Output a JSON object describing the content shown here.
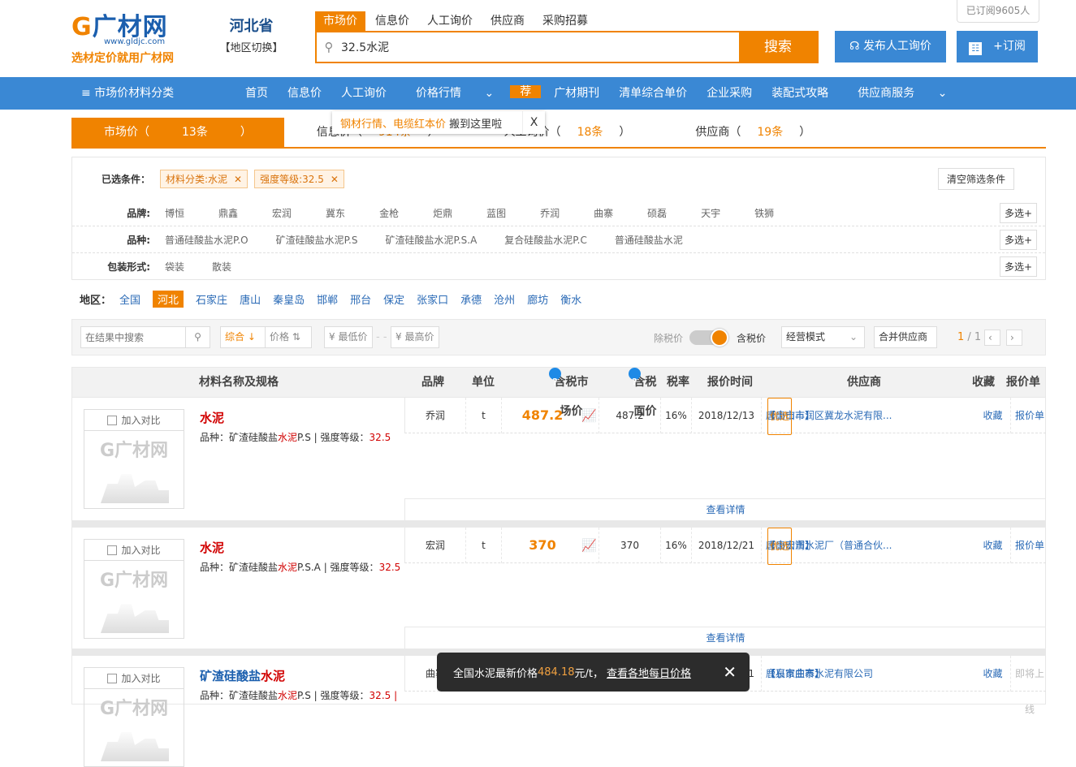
{
  "header": {
    "logo_text": "广材网",
    "logo_url": "www.gldjc.com",
    "slogan": "选材定价就用广材网",
    "province": "河北省",
    "region_switch": "【地区切换】",
    "subscribed": "已订阅9605人",
    "search_tabs": [
      "市场价",
      "信息价",
      "人工询价",
      "供应商",
      "采购招募"
    ],
    "search_value": "32.5水泥",
    "search_button": "搜索",
    "publish_button": "发布人工询价",
    "subscribe_button": "+订阅"
  },
  "nav": {
    "category": "≡ 市场价材料分类",
    "items": [
      "首页",
      "信息价",
      "人工询价",
      "价格行情",
      "广材期刊",
      "清单综合单价",
      "企业采购",
      "装配式攻略",
      "供应商服务"
    ],
    "tag": "荐"
  },
  "tooltip": {
    "highlight": "钢材行情、电缆红本价",
    "text": " 搬到这里啦",
    "close": "X"
  },
  "result_tabs": [
    {
      "label": "市场价（",
      "count": "13条",
      "end": "）"
    },
    {
      "label": "信息价（",
      "count": "914条",
      "end": "）"
    },
    {
      "label": "人工询价（",
      "count": "18条",
      "end": "）"
    },
    {
      "label": "供应商（",
      "count": "19条",
      "end": "）"
    }
  ],
  "filters": {
    "selected_label": "已选条件：",
    "chips": [
      "材料分类:水泥",
      "强度等级:32.5"
    ],
    "clear": "清空筛选条件",
    "brand_label": "品牌:",
    "brands": [
      "博恒",
      "鼎鑫",
      "宏润",
      "冀东",
      "金枪",
      "炬鼎",
      "蓝图",
      "乔润",
      "曲寨",
      "硕磊",
      "天宇",
      "铁狮"
    ],
    "variety_label": "品种:",
    "varieties": [
      "普通硅酸盐水泥P.O",
      "矿渣硅酸盐水泥P.S",
      "矿渣硅酸盐水泥P.S.A",
      "复合硅酸盐水泥P.C",
      "普通硅酸盐水泥"
    ],
    "pack_label": "包装形式:",
    "packs": [
      "袋装",
      "散装"
    ],
    "multi": "多选+"
  },
  "region": {
    "label": "地区：",
    "items": [
      "全国",
      "河北",
      "石家庄",
      "唐山",
      "秦皇岛",
      "邯郸",
      "邢台",
      "保定",
      "张家口",
      "承德",
      "沧州",
      "廊坊",
      "衡水"
    ],
    "selected": "河北"
  },
  "toolbar": {
    "search_placeholder": "在结果中搜索",
    "sort_default": "综合 ↓",
    "sort_price": "价格",
    "min_price": "¥ 最低价",
    "max_price": "¥ 最高价",
    "ex_tax": "除税价",
    "in_tax": "含税价",
    "mode": "经营模式",
    "merge": "合并供应商",
    "page_cur": "1",
    "page_total": "/ 1"
  },
  "table": {
    "headers": [
      "材料名称及规格",
      "品牌",
      "单位",
      "含税市场价",
      "含税面价",
      "税率",
      "报价时间",
      "供应商",
      "收藏",
      "报价单"
    ],
    "compare": "加入对比",
    "detail": "查看详情",
    "spec_prefix": "品种：",
    "grade_sep": " | 强度等级：",
    "rows": [
      {
        "name": "水泥",
        "spec_a": "矿渣硅酸盐",
        "spec_hl": "水泥",
        "spec_b": "P.S",
        "grade": "32.5",
        "brand": "乔润",
        "unit": "t",
        "price": "487.2",
        "face": "487.2",
        "tax": "16%",
        "date": "2018/12/13",
        "city": "【唐山市】",
        "supplier": "唐山市丰润区冀龙水泥有限...",
        "badge": "优选",
        "fav": "收藏",
        "quote": "报价单"
      },
      {
        "name": "水泥",
        "spec_a": "矿渣硅酸盐",
        "spec_hl": "水泥",
        "spec_b": "P.S.A",
        "grade": "32.5",
        "brand": "宏润",
        "unit": "t",
        "price": "370",
        "face": "370",
        "tax": "16%",
        "date": "2018/12/21",
        "city": "【唐山市】",
        "supplier": "唐山宏润水泥厂（普通合伙...",
        "badge": "优选",
        "fav": "收藏",
        "quote": "报价单"
      },
      {
        "name_a": "矿渣硅酸盐",
        "name_hl": "水泥",
        "spec_a": "矿渣硅酸盐",
        "spec_hl": "水泥",
        "spec_b": "P.S",
        "grade": "32.5 |",
        "brand": "曲寨",
        "date": "2018/12/11",
        "city": "【石家庄市】",
        "supplier": "鹿泉市曲寨水泥有限公司",
        "fav": "收藏",
        "quote": "即将上线"
      }
    ]
  },
  "toast": {
    "text": "全国水泥最新价格",
    "price": "484.18",
    "unit": "元/t，",
    "link": "查看各地每日价格",
    "close": "✕"
  },
  "colors": {
    "brand_orange": "#f08300",
    "nav_blue": "#3a88d4",
    "link_blue": "#2a6ab6",
    "red": "#d10000"
  }
}
